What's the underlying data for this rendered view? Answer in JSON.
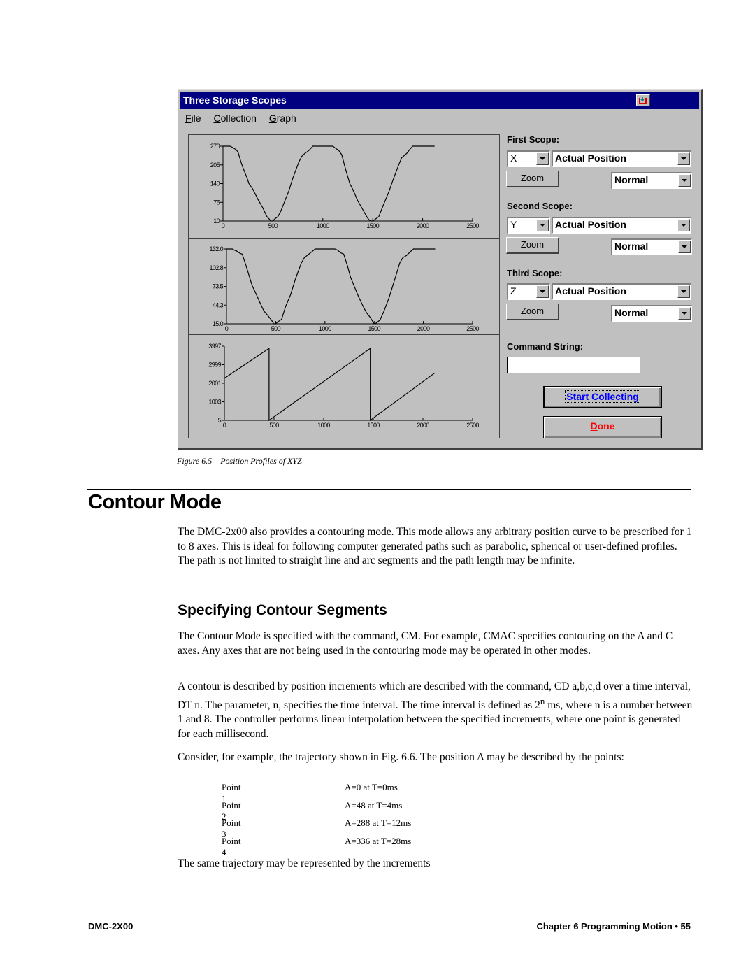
{
  "dialog": {
    "title": "Three Storage Scopes",
    "menu": [
      {
        "label": "File",
        "accel": "F",
        "rest": "ile"
      },
      {
        "label": "Collection",
        "accel": "C",
        "rest": "ollection"
      },
      {
        "label": "Graph",
        "accel": "G",
        "rest": "raph"
      }
    ],
    "scopes": [
      {
        "heading": "First Scope:",
        "axis": "X",
        "signal": "Actual Position",
        "zoom_label": "Zoom",
        "mode": "Normal"
      },
      {
        "heading": "Second Scope:",
        "axis": "Y",
        "signal": "Actual Position",
        "zoom_label": "Zoom",
        "mode": "Normal"
      },
      {
        "heading": "Third Scope:",
        "axis": "Z",
        "signal": "Actual Position",
        "zoom_label": "Zoom",
        "mode": "Normal"
      }
    ],
    "command_string": {
      "label": "Command String:",
      "value": ""
    },
    "start_button": {
      "accel": "S",
      "rest": "tart Collecting"
    },
    "done_button": {
      "accel": "D",
      "rest": "one"
    },
    "colors": {
      "titlebar": "#000080",
      "face": "#c0c0c0",
      "start_text": "#0000ff",
      "done_text": "#ff0000"
    }
  },
  "chart_data": [
    {
      "type": "line",
      "title": "X Actual Position",
      "xlabel": "",
      "ylabel": "",
      "xlim": [
        0,
        2500
      ],
      "ylim": [
        10,
        270
      ],
      "xticks": [
        "0",
        "500",
        "1000",
        "1500",
        "2000",
        "2500"
      ],
      "yticks": [
        "10",
        "75",
        "140",
        "205",
        "270"
      ],
      "x": [
        0,
        70,
        100,
        130,
        150,
        180,
        200,
        240,
        260,
        300,
        350,
        400,
        440,
        460,
        480,
        500,
        520,
        550,
        580,
        620,
        660,
        700,
        760,
        790,
        820,
        860,
        900,
        1000,
        1100,
        1130,
        1160,
        1190,
        1220,
        1240,
        1270,
        1300,
        1350,
        1400,
        1440,
        1460,
        1480,
        1500,
        1520,
        1560,
        1600,
        1660,
        1700,
        1760,
        1790,
        1840,
        1870,
        1900,
        2000,
        2120
      ],
      "values": [
        270,
        270,
        265,
        258,
        250,
        215,
        195,
        160,
        140,
        120,
        85,
        55,
        25,
        18,
        10,
        10,
        18,
        25,
        45,
        80,
        115,
        160,
        215,
        235,
        245,
        255,
        270,
        270,
        270,
        262,
        255,
        240,
        200,
        175,
        140,
        120,
        80,
        50,
        25,
        15,
        10,
        10,
        15,
        25,
        60,
        110,
        150,
        205,
        230,
        245,
        258,
        270,
        270,
        270
      ]
    },
    {
      "type": "line",
      "title": "Y Actual Position",
      "xlabel": "",
      "ylabel": "",
      "xlim": [
        0,
        2500
      ],
      "ylim": [
        15,
        132
      ],
      "xticks": [
        "0",
        "500",
        "1000",
        "1500",
        "2000",
        "2500"
      ],
      "yticks": [
        "15.0",
        "44.3",
        "73.5",
        "102.8",
        "132.0"
      ],
      "x": [
        0,
        60,
        80,
        100,
        140,
        160,
        200,
        240,
        260,
        300,
        340,
        380,
        420,
        460,
        480,
        500,
        520,
        560,
        600,
        650,
        700,
        760,
        790,
        820,
        870,
        900,
        1000,
        1100,
        1130,
        1160,
        1190,
        1230,
        1260,
        1300,
        1340,
        1380,
        1420,
        1460,
        1480,
        1500,
        1520,
        1560,
        1600,
        1650,
        1700,
        1760,
        1790,
        1830,
        1870,
        1900,
        2000,
        2120
      ],
      "values": [
        132,
        132,
        130,
        129,
        125,
        124,
        105,
        85,
        75,
        62,
        48,
        35,
        28,
        20,
        15,
        15,
        18,
        22,
        42,
        60,
        85,
        110,
        118,
        122,
        128,
        132,
        132,
        132,
        130,
        126,
        124,
        105,
        88,
        73,
        58,
        45,
        33,
        25,
        20,
        15,
        16,
        21,
        35,
        55,
        80,
        110,
        118,
        122,
        128,
        132,
        132,
        132
      ]
    },
    {
      "type": "line",
      "title": "Z Actual Position",
      "xlabel": "",
      "ylabel": "",
      "xlim": [
        0,
        2500
      ],
      "ylim": [
        5,
        3997
      ],
      "xticks": [
        "0",
        "500",
        "1000",
        "1500",
        "2000",
        "2500"
      ],
      "yticks": [
        "5",
        "1003",
        "2001",
        "2999",
        "3997"
      ],
      "x": [
        0,
        450,
        450,
        1470,
        1470,
        2120
      ],
      "values": [
        2270,
        3880,
        5,
        3880,
        5,
        2560
      ]
    }
  ],
  "caption": "Figure 6.5 – Position Profiles of XYZ",
  "section_title": "Contour Mode",
  "intro_paragraph": "The DMC-2x00 also provides a contouring mode.  This mode allows any arbitrary position curve to be prescribed for 1 to 8 axes.  This is ideal for following computer generated paths such as parabolic, spherical or user-defined profiles.  The path is not limited to straight line and arc segments and the path length may be infinite.",
  "subsection_title": "Specifying Contour Segments",
  "paragraph_1": "The Contour Mode is specified with the command, CM.  For example, CMAC specifies contouring on the A and C axes.  Any axes that are not being used in the contouring mode may be operated in other modes.",
  "paragraph_2_a": "A contour is described by position increments which are described with the command, CD a,b,c,d over a time interval, DT n.  The parameter, n, specifies the time interval.  The time interval is defined as 2",
  "paragraph_2_sup": "n",
  "paragraph_2_b": " ms, where n is a number between 1 and 8.  The controller performs linear interpolation between the specified increments, where one point is generated for each millisecond.",
  "paragraph_3": "Consider, for example, the trajectory shown in Fig. 6.6.  The position A may be described by the points:",
  "points": [
    {
      "name": "Point 1",
      "value": "A=0 at T=0ms"
    },
    {
      "name": "Point 2",
      "value": "A=48 at T=4ms"
    },
    {
      "name": "Point 3",
      "value": "A=288 at T=12ms"
    },
    {
      "name": "Point 4",
      "value": "A=336 at T=28ms"
    }
  ],
  "paragraph_4": "The same trajectory may be represented by the increments",
  "footer": {
    "left": "DMC-2X00",
    "right": "Chapter 6  Programming Motion  •  55"
  }
}
